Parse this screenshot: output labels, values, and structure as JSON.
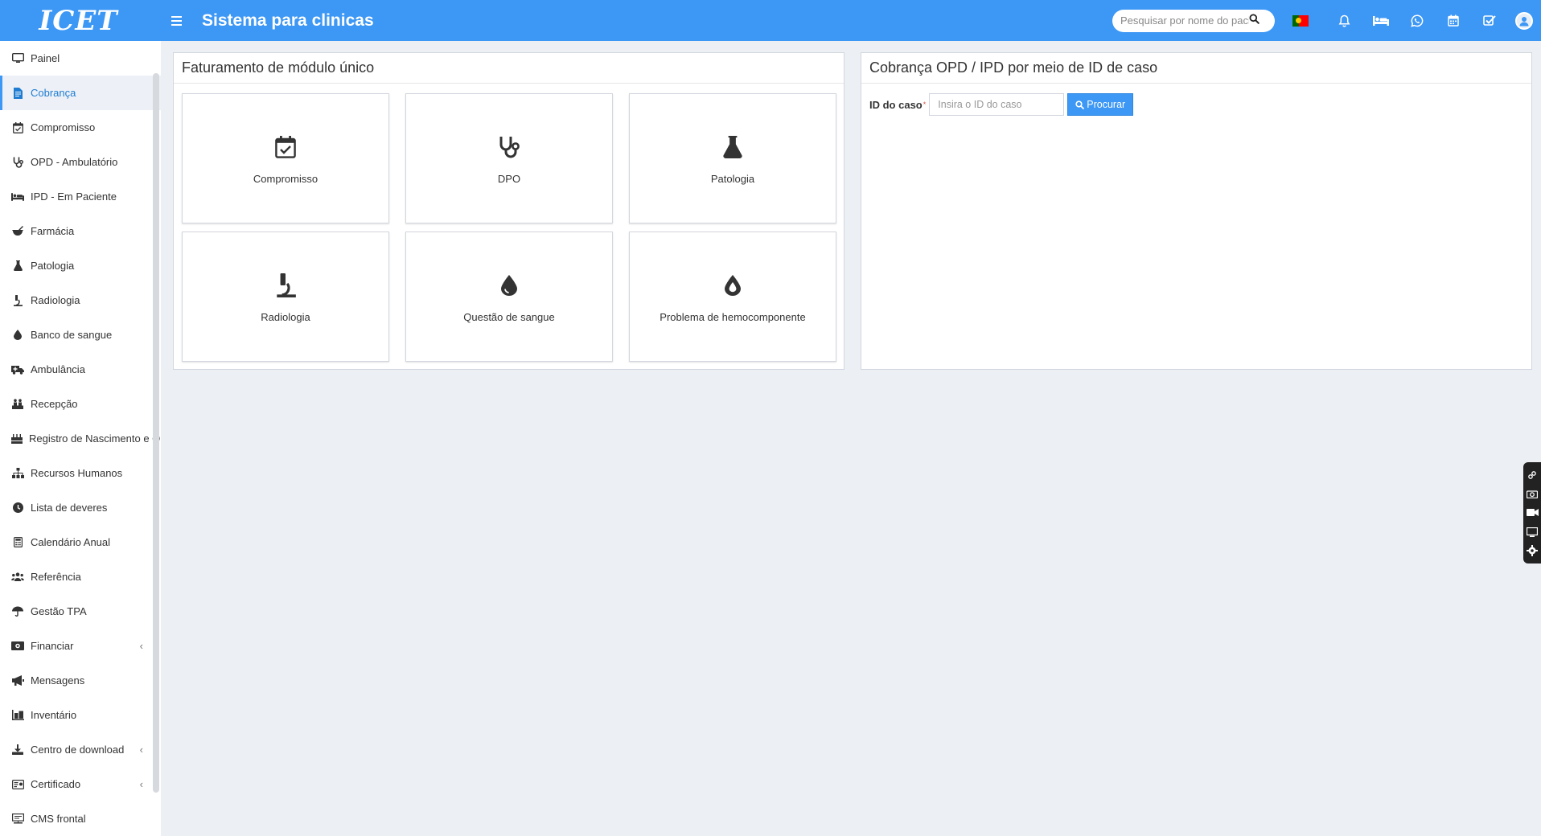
{
  "header": {
    "logo_text": "ICET",
    "app_title": "Sistema para clinicas",
    "search_placeholder": "Pesquisar por nome do paciente",
    "icons": [
      "search-icon",
      "portugal-flag-icon",
      "bell-icon",
      "bed-icon",
      "whatsapp-icon",
      "calendar-icon",
      "task-check-icon",
      "user-avatar-icon"
    ]
  },
  "sidebar": {
    "items": [
      {
        "label": "Painel",
        "icon": "monitor-icon"
      },
      {
        "label": "Cobrança",
        "icon": "invoice-icon",
        "active": true
      },
      {
        "label": "Compromisso",
        "icon": "calendar-check-icon"
      },
      {
        "label": "OPD - Ambulatório",
        "icon": "stethoscope-icon"
      },
      {
        "label": "IPD - Em Paciente",
        "icon": "bed-icon"
      },
      {
        "label": "Farmácia",
        "icon": "mortar-pestle-icon"
      },
      {
        "label": "Patologia",
        "icon": "flask-icon"
      },
      {
        "label": "Radiologia",
        "icon": "microscope-icon"
      },
      {
        "label": "Banco de sangue",
        "icon": "blood-drop-icon"
      },
      {
        "label": "Ambulância",
        "icon": "ambulance-icon"
      },
      {
        "label": "Recepção",
        "icon": "reception-icon"
      },
      {
        "label": "Registro de Nascimento e Óbito",
        "icon": "birthday-cake-icon"
      },
      {
        "label": "Recursos Humanos",
        "icon": "sitemap-icon"
      },
      {
        "label": "Lista de deveres",
        "icon": "clock-icon"
      },
      {
        "label": "Calendário Anual",
        "icon": "calculator-icon"
      },
      {
        "label": "Referência",
        "icon": "users-icon"
      },
      {
        "label": "Gestão TPA",
        "icon": "umbrella-icon"
      },
      {
        "label": "Financiar",
        "icon": "money-icon",
        "has_children": true
      },
      {
        "label": "Mensagens",
        "icon": "bullhorn-icon"
      },
      {
        "label": "Inventário",
        "icon": "inventory-icon"
      },
      {
        "label": "Centro de download",
        "icon": "download-icon",
        "has_children": true
      },
      {
        "label": "Certificado",
        "icon": "certificate-icon",
        "has_children": true
      },
      {
        "label": "CMS frontal",
        "icon": "sitemap-web-icon"
      }
    ],
    "chevron": "‹"
  },
  "billing_panel": {
    "title": "Faturamento de módulo único",
    "tiles": [
      {
        "label": "Compromisso",
        "icon": "calendar-check-icon"
      },
      {
        "label": "DPO",
        "icon": "stethoscope-icon"
      },
      {
        "label": "Patologia",
        "icon": "flask-icon"
      },
      {
        "label": "Radiologia",
        "icon": "microscope-icon"
      },
      {
        "label": "Questão de sangue",
        "icon": "blood-drop-icon"
      },
      {
        "label": "Problema de hemocomponente",
        "icon": "blood-drop-outline-icon"
      }
    ]
  },
  "case_panel": {
    "title": "Cobrança OPD / IPD por meio de ID de caso",
    "case_label": "ID do caso",
    "required_mark": "*",
    "case_placeholder": "Insira o ID do caso",
    "search_button": "Procurar"
  },
  "colors": {
    "header_bg": "#3c97f5",
    "active_text": "#1f7cd1",
    "page_bg": "#ecf0f5"
  }
}
